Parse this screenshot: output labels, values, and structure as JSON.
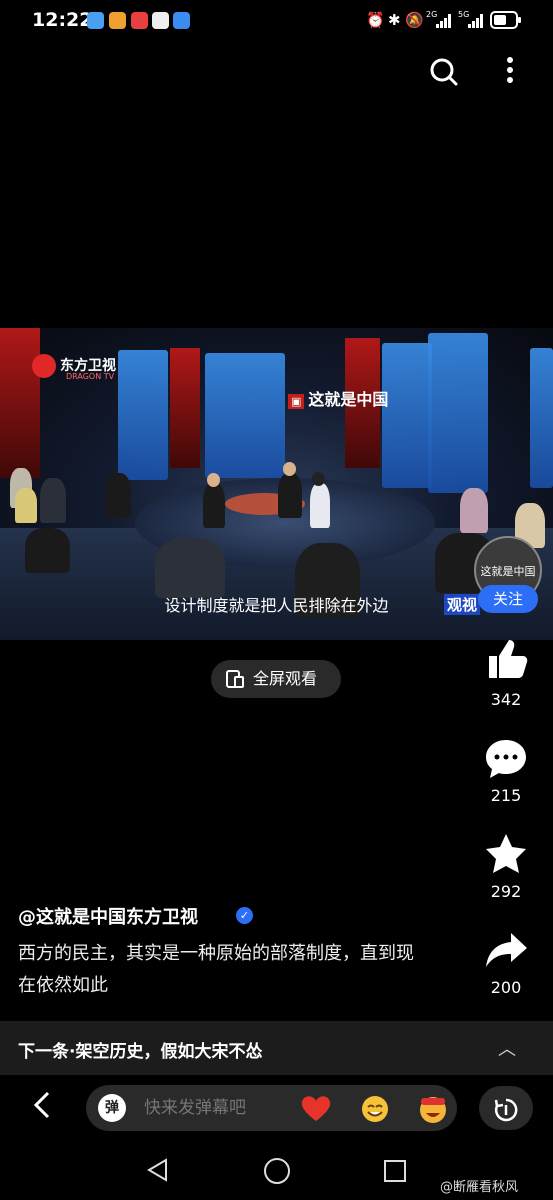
{
  "status_bar": {
    "time": "12:22",
    "network_1": "2G",
    "network_2": "5G",
    "icons": [
      "alarm-icon",
      "bluetooth-icon",
      "mute-icon",
      "signal-icon",
      "battery-icon"
    ]
  },
  "video": {
    "channel_logo": "东方卫视",
    "channel_logo_en": "DRAGON TV",
    "show_logo": "这就是中国",
    "subtitle": "设计制度就是把人民排除在外边",
    "corner_text": "观视",
    "avatar_text": "这就是中国",
    "follow_label": "关注"
  },
  "fullscreen_label": "全屏观看",
  "actions": {
    "likes": "342",
    "comments": "215",
    "favorites": "292",
    "shares": "200"
  },
  "author": "@这就是中国东方卫视",
  "description": "西方的民主，其实是一种原始的部落制度，直到现在依然如此",
  "next": {
    "label": "下一条·架空历史，假如大宋不怂"
  },
  "danmu": {
    "icon_label": "弹",
    "placeholder": "快来发弹幕吧"
  },
  "watermark": "@断雁看秋风",
  "colors": {
    "accent": "#2d6ef7",
    "background": "#000000"
  }
}
